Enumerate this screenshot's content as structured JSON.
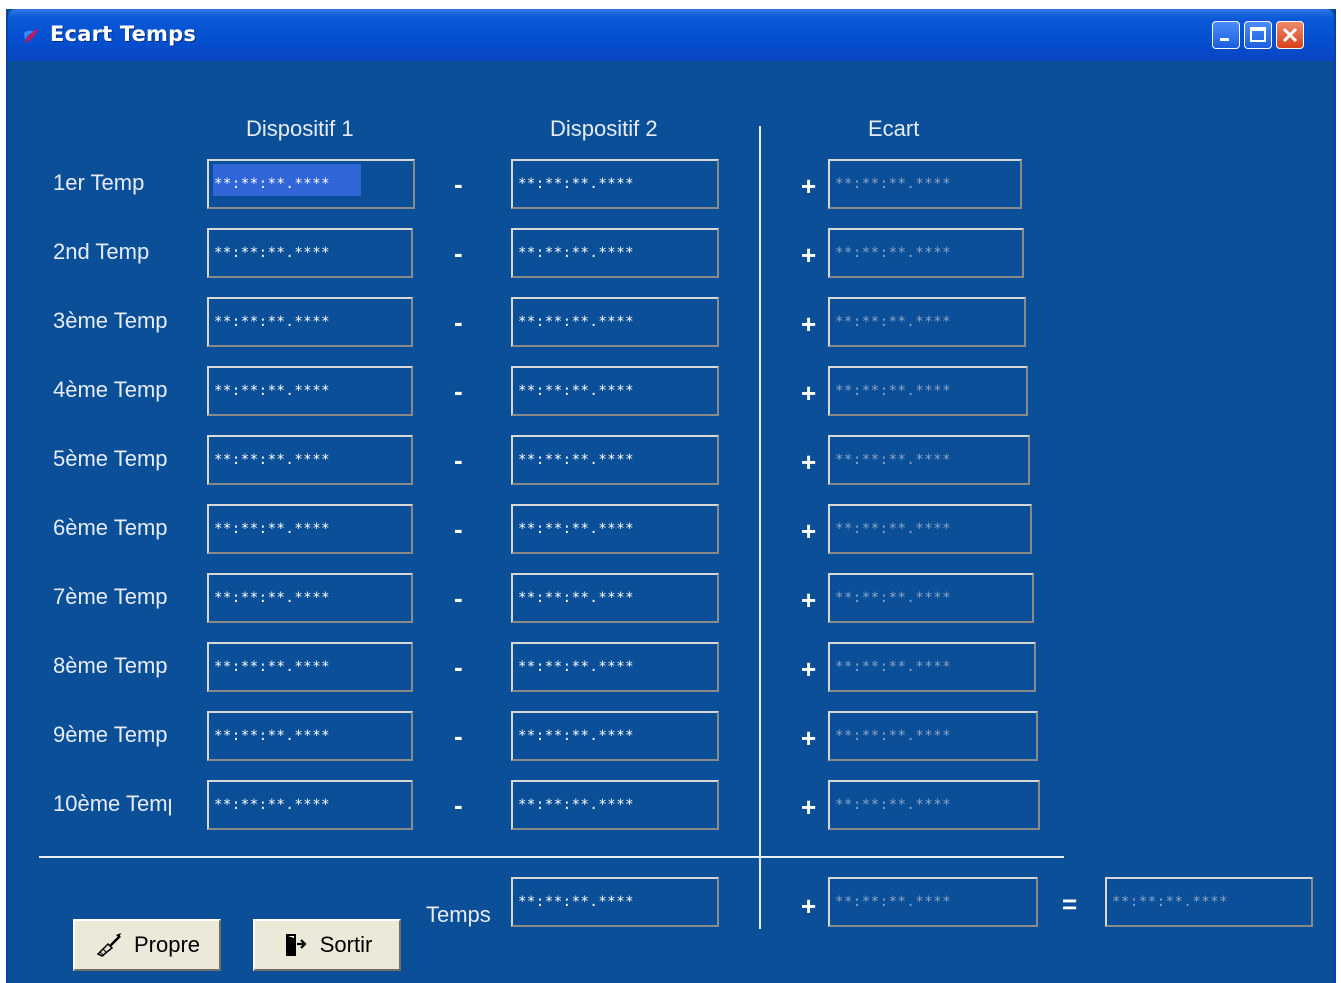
{
  "window": {
    "title": "Ecart Temps",
    "controls": {
      "minimize": "minimize-icon",
      "maximize": "maximize-icon",
      "close": "close-icon"
    }
  },
  "headers": {
    "device1": "Dispositif 1",
    "device2": "Dispositif 2",
    "gap": "Ecart"
  },
  "field_mask": "**:**:**.****",
  "rows": [
    {
      "label": "1er Temp"
    },
    {
      "label": "2nd Temp"
    },
    {
      "label": "3ème Temp"
    },
    {
      "label": "4ème Temp"
    },
    {
      "label": "5ème Temp"
    },
    {
      "label": "6ème Temp"
    },
    {
      "label": "7ème Temp"
    },
    {
      "label": "8ème Temp"
    },
    {
      "label": "9ème Temp"
    },
    {
      "label": "10ème Temp"
    }
  ],
  "operators": {
    "minus": "-",
    "plus": "+",
    "equals": "="
  },
  "footer": {
    "temps_label": "Temps"
  },
  "buttons": {
    "clean": {
      "label": "Propre",
      "icon": "broom-icon"
    },
    "exit": {
      "label": "Sortir",
      "icon": "exit-door-icon"
    }
  },
  "colors": {
    "background": "#0A4F97",
    "titlebar": "#0450D0",
    "button_face": "#ECE9D8",
    "text": "#FFFFFF"
  }
}
